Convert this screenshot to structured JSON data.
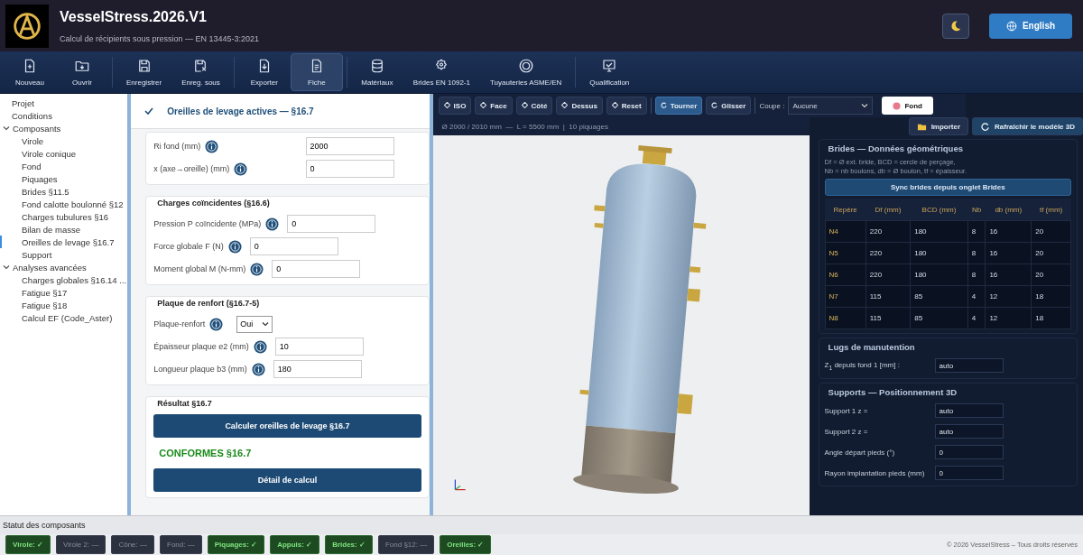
{
  "app": {
    "title": "VesselStress.2026.V1",
    "subtitle": "Calcul de récipients sous pression — EN 13445-3:2021",
    "language": "English"
  },
  "toolbar": [
    [
      {
        "label": "Nouveau",
        "selected": false
      },
      {
        "label": "Ouvrir",
        "selected": false
      }
    ],
    [
      {
        "label": "Enregistrer",
        "selected": false
      },
      {
        "label": "Enreg. sous",
        "selected": false
      }
    ],
    [
      {
        "label": "Exporter",
        "selected": false
      },
      {
        "label": "Fiche",
        "selected": true
      }
    ],
    [
      {
        "label": "Matériaux",
        "selected": false
      },
      {
        "label": "Brides EN 1092-1",
        "selected": false
      },
      {
        "label": "Tuyauteries ASME/EN",
        "selected": false
      }
    ],
    [
      {
        "label": "Qualification",
        "selected": false
      }
    ]
  ],
  "tree": [
    {
      "label": "Projet",
      "selected": false
    },
    {
      "label": "Conditions",
      "selected": false
    },
    {
      "label": "Composants",
      "expanded": true,
      "selected": false,
      "children": [
        {
          "label": "Virole",
          "selected": false
        },
        {
          "label": "Virole conique",
          "selected": false
        },
        {
          "label": "Fond",
          "selected": false
        },
        {
          "label": "Piquages",
          "selected": false
        },
        {
          "label": "Brides §11.5",
          "selected": false
        },
        {
          "label": "Fond calotte boulonné §12",
          "selected": false
        },
        {
          "label": "Charges tubulures §16",
          "selected": false
        },
        {
          "label": "Bilan de masse",
          "selected": false
        },
        {
          "label": "Oreilles de levage §16.7",
          "selected": true
        },
        {
          "label": "Support",
          "selected": false
        }
      ]
    },
    {
      "label": "Analyses avancées",
      "expanded": true,
      "selected": false,
      "children": [
        {
          "label": "Charges globales §16.14 ...",
          "selected": false
        },
        {
          "label": "Fatigue §17",
          "selected": false
        },
        {
          "label": "Fatigue §18",
          "selected": false
        },
        {
          "label": "Calcul EF (Code_Aster)",
          "selected": false
        }
      ]
    }
  ],
  "form": {
    "header": {
      "label": "Oreilles de levage actives — §16.7",
      "checked": true
    },
    "sections": [
      {
        "rows": [
          {
            "kind": "input",
            "label": "Ri fond (mm)",
            "value": "2000"
          },
          {
            "kind": "input",
            "label": "x (axe→oreille) (mm)",
            "value": "0"
          }
        ]
      },
      {
        "title": "Charges coïncidentes (§16.6)",
        "rows": [
          {
            "kind": "input",
            "label": "Pression P coïncidente (MPa)",
            "value": "0"
          },
          {
            "kind": "input",
            "label": "Force globale F (N)",
            "value": "0"
          },
          {
            "kind": "input",
            "label": "Moment global M (N-mm)",
            "value": "0"
          }
        ]
      },
      {
        "title": "Plaque de renfort (§16.7-5)",
        "rows": [
          {
            "kind": "select",
            "label": "Plaque-renfort",
            "value": "Oui"
          },
          {
            "kind": "input",
            "label": "Épaisseur plaque e2 (mm)",
            "value": "10"
          },
          {
            "kind": "input",
            "label": "Longueur plaque b3 (mm)",
            "value": "180"
          }
        ]
      }
    ],
    "result": {
      "title": "Résultat §16.7",
      "compute_button": "Calculer oreilles de levage §16.7",
      "status": "CONFORMES §16.7",
      "ok": true,
      "detail_button": "Détail de calcul"
    }
  },
  "viewer": {
    "view_buttons": [
      {
        "label": "ISO"
      },
      {
        "label": "Face"
      },
      {
        "label": "Côté"
      },
      {
        "label": "Dessus"
      },
      {
        "label": "Reset"
      }
    ],
    "mode_buttons": [
      {
        "label": "Tourner",
        "selected": true
      },
      {
        "label": "Glisser",
        "selected": false
      }
    ],
    "cut_label": "Coupe :",
    "cut_value": "Aucune",
    "background_button": "Fond",
    "info": "Ø 2000 / 2010 mm  —  L = 5500 mm  |  10 piquages",
    "import_button": "Importer",
    "refresh_button": "Rafraîchir le modèle 3D"
  },
  "flanges": {
    "title": "Brides — Données géométriques",
    "note": "Df = Ø ext. bride, BCD = cercle de perçage,\nNb = nb boulons, db = Ø boulon, tf = épaisseur.",
    "sync_button": "Sync brides depuis onglet Brides",
    "columns": [
      "Repère",
      "Df (mm)",
      "BCD (mm)",
      "Nb",
      "db (mm)",
      "tf (mm)"
    ],
    "rows": [
      [
        "N4",
        "220",
        "180",
        "8",
        "16",
        "20"
      ],
      [
        "N5",
        "220",
        "180",
        "8",
        "16",
        "20"
      ],
      [
        "N6",
        "220",
        "180",
        "8",
        "16",
        "20"
      ],
      [
        "N7",
        "115",
        "85",
        "4",
        "12",
        "18"
      ],
      [
        "N8",
        "115",
        "85",
        "4",
        "12",
        "18"
      ]
    ]
  },
  "lugs": {
    "title": "Lugs de manutention",
    "rows": [
      {
        "label": "Z$_{1}$ depuis fond 1 [mm] :",
        "value": "auto"
      }
    ]
  },
  "supports": {
    "title": "Supports — Positionnement 3D",
    "rows": [
      {
        "label": "Support 1  z =",
        "value": "auto"
      },
      {
        "label": "Support 2  z =",
        "value": "auto"
      },
      {
        "label": "Angle départ pieds (°)",
        "value": "0"
      },
      {
        "label": "Rayon implantation pieds (mm)",
        "value": "0"
      }
    ]
  },
  "status": {
    "title": "Statut des composants",
    "chips": [
      {
        "label": "Virole: ✓",
        "ok": true
      },
      {
        "label": "Virole 2: —",
        "ok": false
      },
      {
        "label": "Cône: —",
        "ok": false
      },
      {
        "label": "Fond: —",
        "ok": false
      },
      {
        "label": "Piquages: ✓",
        "ok": true
      },
      {
        "label": "Appuis: ✓",
        "ok": true
      },
      {
        "label": "Brides: ✓",
        "ok": true
      },
      {
        "label": "Fond §12: —",
        "ok": false
      },
      {
        "label": "Oreilles: ✓",
        "ok": true
      }
    ],
    "copyright": "© 2026 VesselStress – Tous droits réservés"
  }
}
